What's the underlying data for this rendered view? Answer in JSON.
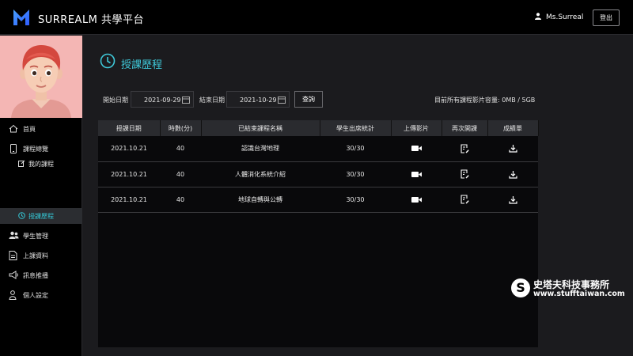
{
  "header": {
    "brand": "SURREALM 共學平台",
    "user_name": "Ms.Surreal",
    "logout_label": "登出"
  },
  "sidebar": {
    "items": [
      {
        "label": "首頁",
        "icon": "home-icon"
      },
      {
        "label": "課程總覽",
        "icon": "tablet-icon"
      },
      {
        "label": "我的課程",
        "icon": "edit-icon"
      },
      {
        "label": "授課歷程",
        "icon": "clock-icon",
        "active": true
      },
      {
        "label": "學生管理",
        "icon": "users-icon"
      },
      {
        "label": "上課資料",
        "icon": "document-icon"
      },
      {
        "label": "訊息推播",
        "icon": "megaphone-icon"
      },
      {
        "label": "個人設定",
        "icon": "person-icon"
      }
    ]
  },
  "page": {
    "title": "授課歷程"
  },
  "filters": {
    "start_label": "開始日期",
    "start_value": "2021-09-29",
    "end_label": "結束日期",
    "end_value": "2021-10-29",
    "search_label": "查詢",
    "storage_text": "目前所有課程影片容量: 0MB / 5GB"
  },
  "table": {
    "headers": [
      "授課日期",
      "時數(分)",
      "已結束課程名稱",
      "學生出席統計",
      "上傳影片",
      "再次開課",
      "成績單"
    ],
    "rows": [
      {
        "date": "2021.10.21",
        "minutes": "40",
        "course": "認識台灣地理",
        "attendance": "30/30"
      },
      {
        "date": "2021.10.21",
        "minutes": "40",
        "course": "人體消化系統介紹",
        "attendance": "30/30"
      },
      {
        "date": "2021.10.21",
        "minutes": "40",
        "course": "地球自轉與公轉",
        "attendance": "30/30"
      }
    ]
  },
  "watermark": {
    "logo_letter": "S",
    "name": "史塔夫科技事務所",
    "url": "www.stufftaiwan.com"
  },
  "colors": {
    "accent": "#35c8d6",
    "logo_blue": "#3a7bff"
  }
}
